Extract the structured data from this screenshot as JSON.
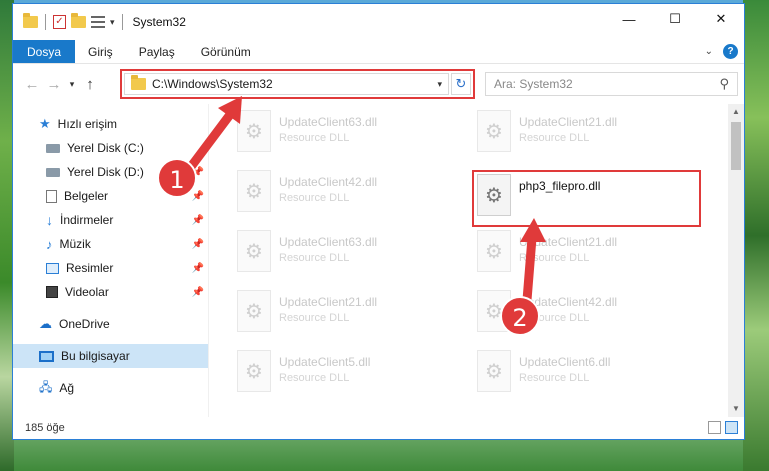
{
  "window": {
    "title": "System32",
    "controls": {
      "minimize": "—",
      "maximize": "☐",
      "close": "✕"
    }
  },
  "ribbon": {
    "tabs": [
      "Dosya",
      "Giriş",
      "Paylaş",
      "Görünüm"
    ],
    "help": "?"
  },
  "nav": {
    "back": "←",
    "forward": "→",
    "recent": "▾",
    "up": "↑",
    "address": "C:\\Windows\\System32",
    "search_placeholder": "Ara: System32"
  },
  "sidebar": {
    "items": [
      {
        "label": "Hızlı erişim",
        "icon": "star-icon",
        "level": "top"
      },
      {
        "label": "Yerel Disk (C:)",
        "icon": "drive-icon",
        "level": "sub"
      },
      {
        "label": "Yerel Disk (D:)",
        "icon": "drive-icon",
        "level": "sub",
        "pinned": true
      },
      {
        "label": "Belgeler",
        "icon": "document-icon",
        "level": "sub",
        "pinned": true
      },
      {
        "label": "İndirmeler",
        "icon": "download-icon",
        "level": "sub",
        "pinned": true
      },
      {
        "label": "Müzik",
        "icon": "music-icon",
        "level": "sub",
        "pinned": true
      },
      {
        "label": "Resimler",
        "icon": "pictures-icon",
        "level": "sub",
        "pinned": true
      },
      {
        "label": "Videolar",
        "icon": "videos-icon",
        "level": "sub",
        "pinned": true
      },
      {
        "label": "OneDrive",
        "icon": "cloud-icon",
        "level": "top"
      },
      {
        "label": "Bu bilgisayar",
        "icon": "computer-icon",
        "level": "top",
        "selected": true
      },
      {
        "label": "Ağ",
        "icon": "network-icon",
        "level": "top"
      }
    ]
  },
  "files": [
    {
      "name": "UpdateClient63.dll",
      "type": "Resource DLL"
    },
    {
      "name": "UpdateClient21.dll",
      "type": "Resource DLL"
    },
    {
      "name": "UpdateClient42.dll",
      "type": "Resource DLL"
    },
    {
      "name": "php3_filepro.dll",
      "type": "",
      "highlighted": true
    },
    {
      "name": "UpdateClient63.dll",
      "type": "Resource DLL"
    },
    {
      "name": "UpdateClient21.dll",
      "type": "Resource DLL"
    },
    {
      "name": "UpdateClient21.dll",
      "type": "Resource DLL"
    },
    {
      "name": "UpdateClient42.dll",
      "type": "Resource DLL"
    },
    {
      "name": "UpdateClient5.dll",
      "type": "Resource DLL"
    },
    {
      "name": "UpdateClient6.dll",
      "type": "Resource DLL"
    }
  ],
  "status": {
    "item_count": "185 öğe"
  },
  "steps": [
    "1",
    "2"
  ],
  "colors": {
    "accent": "#1979ca",
    "highlight": "#e03a3a",
    "selection": "#cce4f7"
  }
}
